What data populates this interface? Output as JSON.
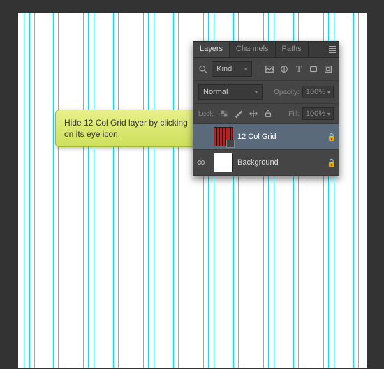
{
  "callout": {
    "text": "Hide 12 Col Grid layer by clicking on its eye icon."
  },
  "panel": {
    "tabs": [
      "Layers",
      "Channels",
      "Paths"
    ],
    "filter": {
      "kind": "Kind"
    },
    "blend": {
      "mode": "Normal",
      "opacity_label": "Opacity:",
      "opacity_value": "100%"
    },
    "lock": {
      "label": "Lock:",
      "fill_label": "Fill:",
      "fill_value": "100%"
    },
    "layers": [
      {
        "name": "12 Col Grid",
        "visible": false,
        "locked": true,
        "selected": true
      },
      {
        "name": "Background",
        "visible": true,
        "locked": true,
        "selected": false
      }
    ]
  },
  "guides_x_pct": [
    1.5,
    3.2,
    4.5,
    10,
    11.3,
    13,
    18.6,
    20,
    21.6,
    27.2,
    28.6,
    30.2,
    35.8,
    37.2,
    38.8,
    44.4,
    45.8,
    47.4,
    53,
    54.4,
    56,
    61.6,
    63,
    64.6,
    70.2,
    71.6,
    73.2,
    78.8,
    80.2,
    81.8,
    87.4,
    88.8,
    90.4,
    96,
    97.4,
    99
  ]
}
